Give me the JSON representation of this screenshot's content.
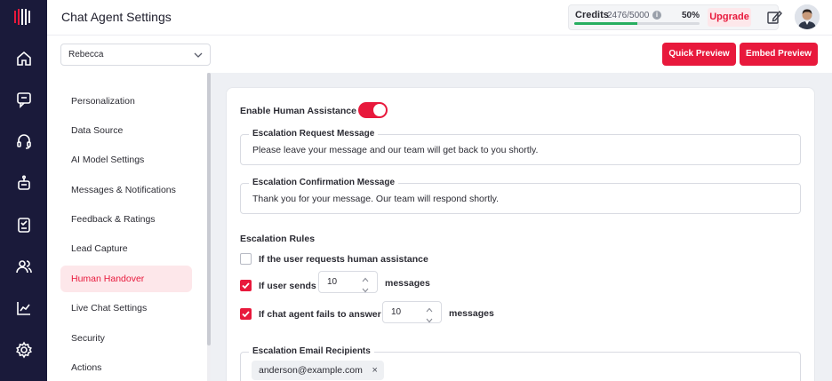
{
  "header": {
    "title": "Chat Agent Settings",
    "credits": {
      "label": "Credits",
      "count": "2476/5000",
      "info_icon": "info-icon",
      "percent": "50%",
      "fraction_used": 0.5,
      "bar_color": "#27ae60"
    },
    "upgrade_label": "Upgrade",
    "edit_icon": "edit-note-icon",
    "avatar_icon": "user-avatar"
  },
  "rail": {
    "logo_icon": "brand-logo",
    "items": [
      {
        "icon": "home-icon"
      },
      {
        "icon": "chat-icon"
      },
      {
        "icon": "headset-icon"
      },
      {
        "icon": "robot-icon"
      },
      {
        "icon": "clipboard-icon"
      },
      {
        "icon": "users-icon"
      },
      {
        "icon": "analytics-icon"
      },
      {
        "icon": "settings-icon"
      }
    ]
  },
  "toolbar": {
    "agent_select_value": "Rebecca",
    "quick_preview_label": "Quick Preview",
    "embed_preview_label": "Embed Preview"
  },
  "menu": {
    "items": [
      {
        "label": "Personalization",
        "active": false
      },
      {
        "label": "Data Source",
        "active": false
      },
      {
        "label": "AI Model Settings",
        "active": false
      },
      {
        "label": "Messages & Notifications",
        "active": false
      },
      {
        "label": "Feedback & Ratings",
        "active": false
      },
      {
        "label": "Lead Capture",
        "active": false
      },
      {
        "label": "Human Handover",
        "active": true
      },
      {
        "label": "Live Chat Settings",
        "active": false
      },
      {
        "label": "Security",
        "active": false
      },
      {
        "label": "Actions",
        "active": false
      }
    ]
  },
  "handover": {
    "enable_label": "Enable Human Assistance",
    "enabled": true,
    "request_msg": {
      "label": "Escalation Request Message",
      "value": "Please leave your message and our team will get back to you shortly."
    },
    "confirm_msg": {
      "label": "Escalation Confirmation Message",
      "value": "Thank you for your message. Our team will respond shortly."
    },
    "rules_title": "Escalation Rules",
    "rules": [
      {
        "label": "If the user requests human assistance",
        "checked": false
      },
      {
        "label": "If user sends",
        "checked": true,
        "count": "10",
        "suffix": "messages"
      },
      {
        "label": "If chat agent fails to answer",
        "checked": true,
        "count": "10",
        "suffix": "messages"
      }
    ],
    "recipients": {
      "label": "Escalation Email Recipients",
      "emails": [
        "anderson@example.com"
      ],
      "remove_glyph": "×"
    }
  },
  "colors": {
    "accent": "#e8193c",
    "rail_bg": "#1a1a3a",
    "active_bg": "#fde7ea"
  }
}
